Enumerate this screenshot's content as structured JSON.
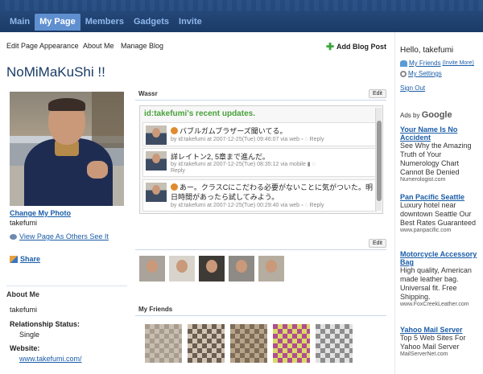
{
  "nav": {
    "tabs": [
      {
        "label": "Main"
      },
      {
        "label": "My Page"
      },
      {
        "label": "Members"
      },
      {
        "label": "Gadgets"
      },
      {
        "label": "Invite"
      }
    ],
    "active": "My Page"
  },
  "toolbar": {
    "edit_appearance": "Edit Page Appearance",
    "about_me": "About Me",
    "manage_blog": "Manage Blog",
    "add_blog_post": "Add Blog Post"
  },
  "page_title": "NoMiMaKuShi !!",
  "profile": {
    "change_photo": "Change My Photo",
    "username": "takefumi",
    "view_as_others": "View Page As Others See It",
    "share": "Share"
  },
  "about": {
    "header": "About Me",
    "name": "takefumi",
    "relationship_label": "Relationship Status:",
    "relationship_value": "Single",
    "website_label": "Website:",
    "website_value": "www.takefumi.com/"
  },
  "wassr": {
    "section_title": "Wassr",
    "edit": "Edit",
    "title": "id:takefumi's recent updates.",
    "updates": [
      {
        "text": "バブルガムブラザーズ聞いてる。",
        "meta": "by id:takefumi at 2007-12-25(Tue) 09:46:07 via web",
        "reply": "Reply"
      },
      {
        "text": "詳レイトン2, 5章まで進んだ。",
        "meta": "by id:takefumi at 2007-12-25(Tue) 08:35:12 via mobile",
        "reply": "Reply"
      },
      {
        "text": "あー。クラスCにこだわる必要がないことに気がついた。明日時間があったら試してみよう。",
        "meta": "by id:takefumi at 2007-12-25(Tue) 00:29:40 via web",
        "reply": "Reply"
      }
    ]
  },
  "gadget2": {
    "edit": "Edit"
  },
  "friends": {
    "header": "My Friends"
  },
  "sidebar": {
    "hello": "Hello, takefumi",
    "my_friends": "My Friends",
    "invite_more": "(Invite More)",
    "my_settings": "My Settings",
    "sign_out": "Sign Out",
    "ads_by": "Ads by",
    "google": "Google",
    "ads": [
      {
        "title": "Your Name Is No Accident",
        "desc": "See Why the Amazing Truth of Your Numerology Chart Cannot Be Denied",
        "url": "Numerologist.com"
      },
      {
        "title": "Pan Pacific Seattle",
        "desc": "Luxury hotel near downtown Seattle Our Best Rates Guaranteed",
        "url": "www.panpacific.com"
      },
      {
        "title": "Motorcycle Accessory Bag",
        "desc": "High quality, American made leather bag. Universal fit. Free Shipping.",
        "url": "www.FoxCreekLeather.com"
      },
      {
        "title": "Yahoo Mail Server",
        "desc": "Top 5 Web Sites For Yahoo Mail Server",
        "url": "MailServerNet.com"
      }
    ]
  },
  "colors": {
    "nav_bg": "#1b3a66",
    "active_tab": "#5f8fcf",
    "link": "#1a5ca8",
    "wassr_green": "#47a23a"
  }
}
